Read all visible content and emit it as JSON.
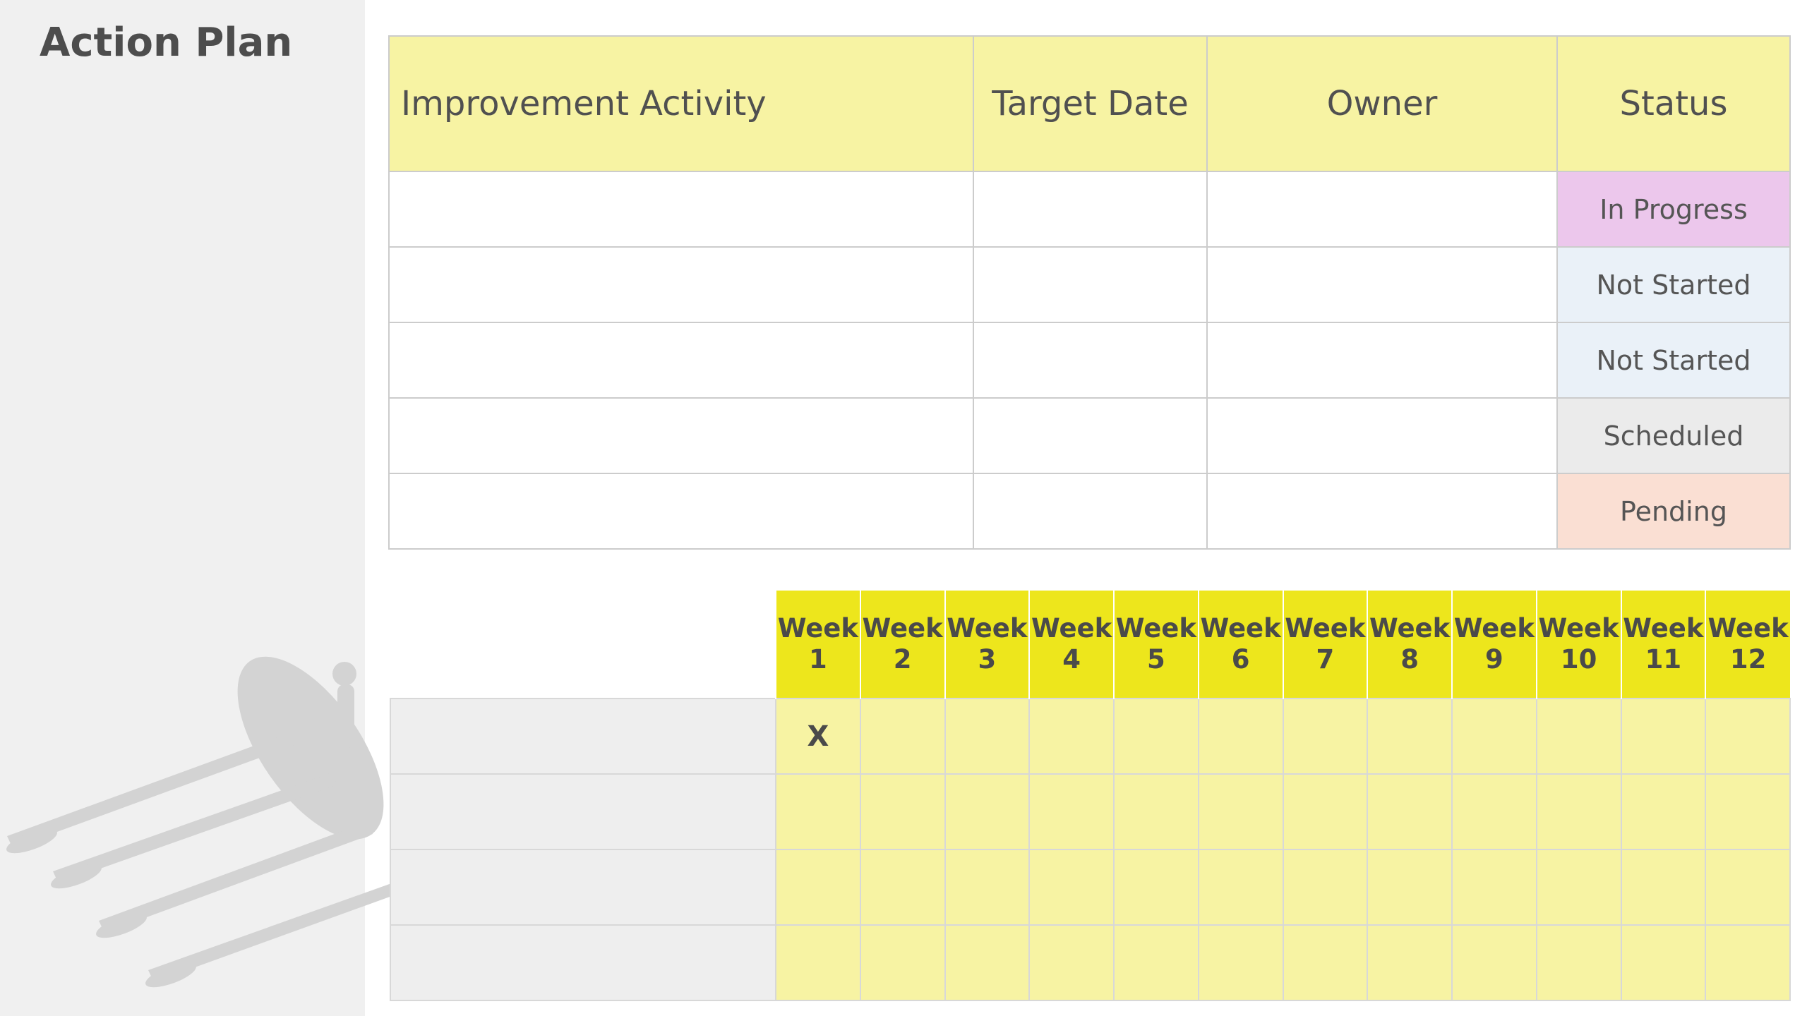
{
  "title": "Action Plan",
  "plan": {
    "headers": {
      "activity": "Improvement Activity",
      "target_date": "Target Date",
      "owner": "Owner",
      "status": "Status"
    },
    "rows": [
      {
        "status": "In Progress",
        "status_color": "#ecc7ec"
      },
      {
        "status": "Not Started",
        "status_color": "#eaf1f8"
      },
      {
        "status": "Not Started",
        "status_color": "#eaf1f8"
      },
      {
        "status": "Scheduled",
        "status_color": "#ebebeb"
      },
      {
        "status": "Pending",
        "status_color": "#fadfd3"
      }
    ]
  },
  "weeks": {
    "headers": [
      [
        "Week",
        "1"
      ],
      [
        "Week",
        "2"
      ],
      [
        "Week",
        "3"
      ],
      [
        "Week",
        "4"
      ],
      [
        "Week",
        "5"
      ],
      [
        "Week",
        "6"
      ],
      [
        "Week",
        "7"
      ],
      [
        "Week",
        "8"
      ],
      [
        "Week",
        "9"
      ],
      [
        "Week",
        "10"
      ],
      [
        "Week",
        "11"
      ],
      [
        "Week",
        "12"
      ]
    ],
    "rows": [
      [
        "X",
        "",
        "",
        "",
        "",
        "",
        "",
        "",
        "",
        "",
        "",
        ""
      ],
      [
        "",
        "",
        "",
        "",
        "",
        "",
        "",
        "",
        "",
        "",
        "",
        ""
      ],
      [
        "",
        "",
        "",
        "",
        "",
        "",
        "",
        "",
        "",
        "",
        "",
        ""
      ],
      [
        "",
        "",
        "",
        "",
        "",
        "",
        "",
        "",
        "",
        "",
        "",
        ""
      ]
    ]
  },
  "colors": {
    "header_yellow": "#f7f3a3",
    "week_header_yellow": "#ede61c",
    "sidebar_gray": "#f0f0f0"
  },
  "decoration": "rowing-silhouette"
}
